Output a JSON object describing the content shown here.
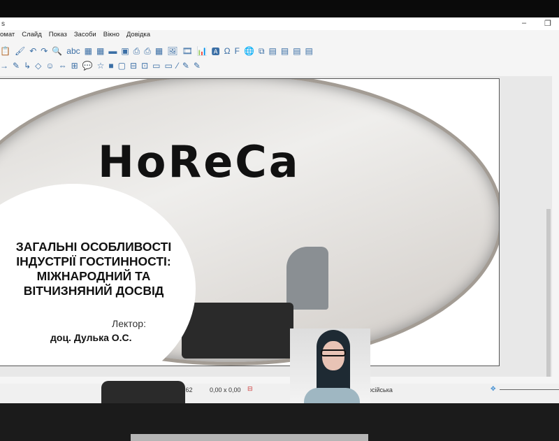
{
  "window": {
    "title_fragment": "s",
    "minimize": "–",
    "restore": "❐"
  },
  "menu": [
    "омат",
    "Слайд",
    "Показ",
    "Засоби",
    "Вікно",
    "Довідка"
  ],
  "toolbar1": [
    "📋",
    "🖌",
    "↶",
    "↷",
    "🔍",
    "abc",
    "▦",
    "▦",
    "▬",
    "▣",
    "⎙",
    "⎙",
    "▦",
    "🖼",
    "🎞",
    "📊",
    "🅰",
    "Ω",
    "F",
    "🌐",
    "⧉",
    "▤",
    "▤",
    "▤",
    "▤"
  ],
  "toolbar2": [
    "→",
    "✎",
    "↳",
    "◇",
    "☺",
    "⇔",
    "⊞",
    "💬",
    "☆",
    "■",
    "▢",
    "⊟",
    "⊡",
    "▭",
    "▭",
    "⁄",
    "✎",
    "✎"
  ],
  "slide": {
    "logo_text": "HoReCa",
    "heading_lines": [
      "ЗАГАЛЬНІ ОСОБЛИВОСТІ",
      "ІНДУСТРІЇ ГОСТИННОСТІ:",
      "МІЖНАРОДНИЙ ТА",
      "ВІТЧИЗНЯНИЙ ДОСВІД"
    ],
    "lecturer_label": "Лектор:",
    "lecturer_name": "доц. Дулька О.С."
  },
  "status": {
    "position": "9.62",
    "size": "0,00 x 0,00",
    "language": "осійська"
  }
}
